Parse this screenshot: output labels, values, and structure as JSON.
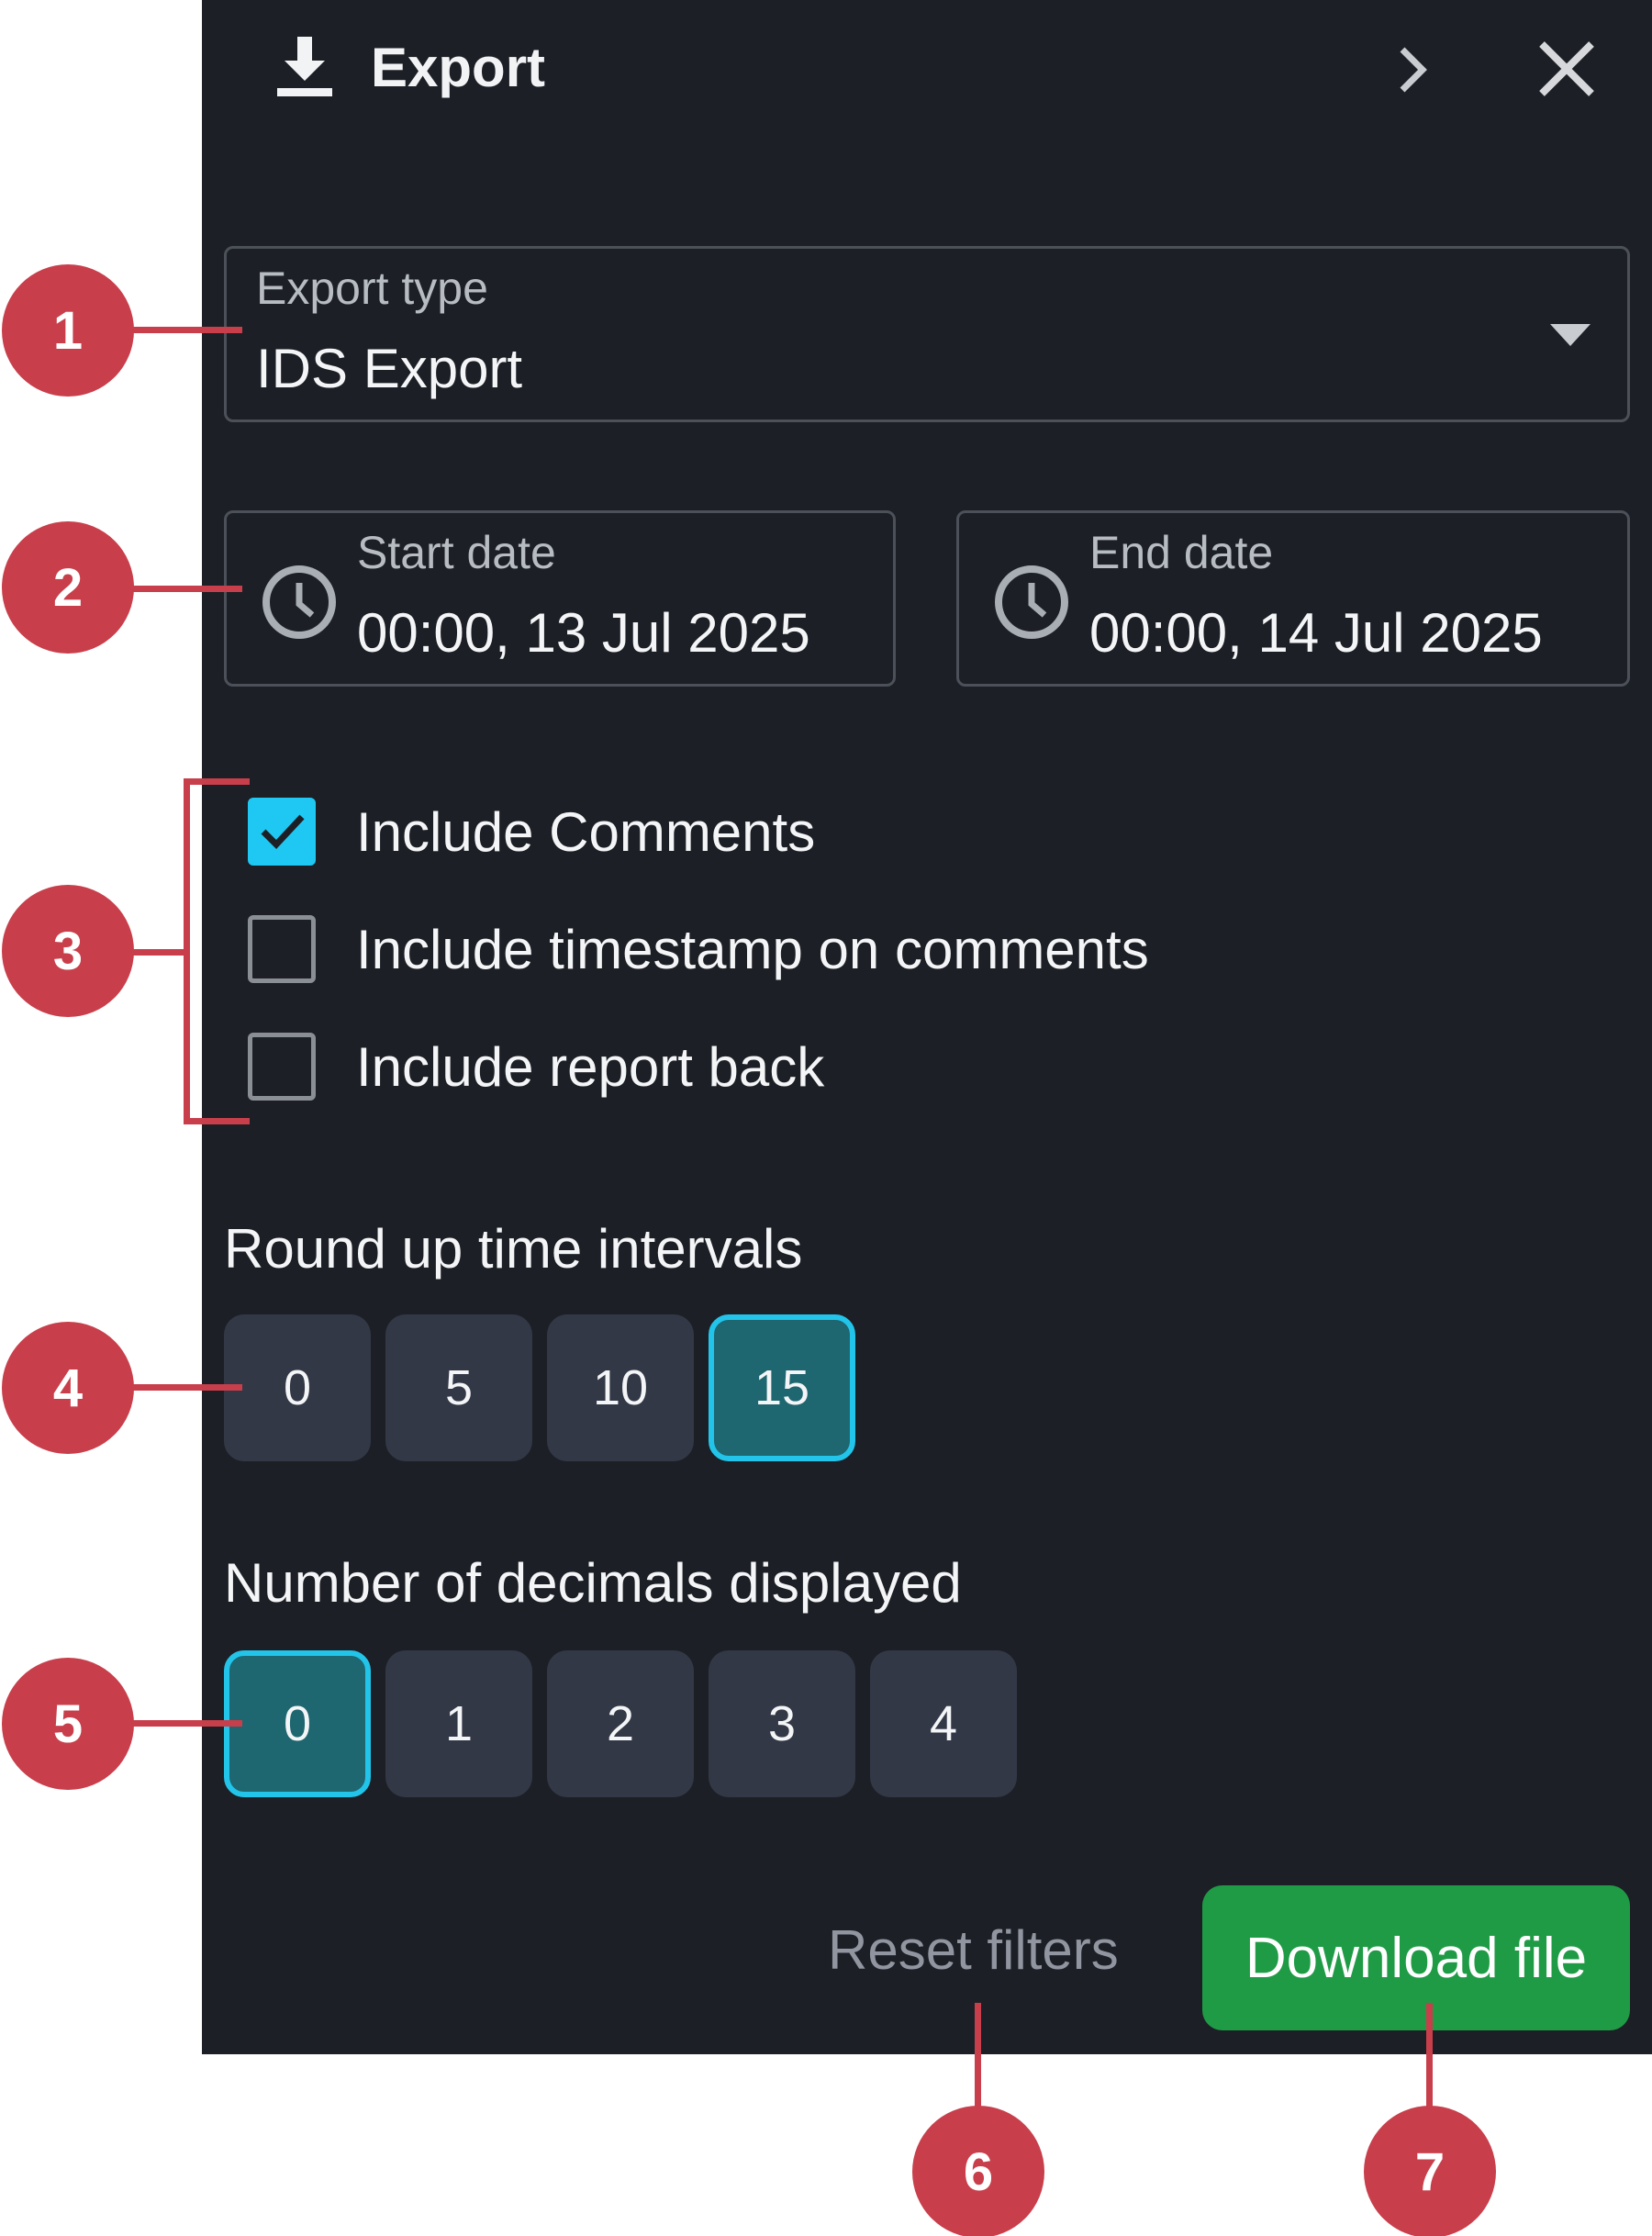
{
  "header": {
    "title": "Export",
    "icons": {
      "title_icon": "download-icon",
      "expand": "chevron-right-icon",
      "close": "close-icon"
    }
  },
  "export_type": {
    "label": "Export type",
    "value": "IDS Export"
  },
  "dates": {
    "start": {
      "label": "Start date",
      "value": "00:00, 13 Jul 2025"
    },
    "end": {
      "label": "End date",
      "value": "00:00, 14 Jul 2025"
    }
  },
  "options": {
    "include_comments": {
      "label": "Include Comments",
      "checked": true
    },
    "include_timestamp": {
      "label": "Include timestamp on comments",
      "checked": false
    },
    "include_report_back": {
      "label": "Include report back",
      "checked": false
    }
  },
  "round_up": {
    "label": "Round up time intervals",
    "values": [
      "0",
      "5",
      "10",
      "15"
    ],
    "selected": "15"
  },
  "decimals": {
    "label": "Number of decimals displayed",
    "values": [
      "0",
      "1",
      "2",
      "3",
      "4"
    ],
    "selected": "0"
  },
  "footer": {
    "reset_label": "Reset filters",
    "download_label": "Download file"
  },
  "callouts": [
    "1",
    "2",
    "3",
    "4",
    "5",
    "6",
    "7"
  ],
  "colors": {
    "panel_bg": "#1c1f25",
    "accent_cyan": "#1ec8f2",
    "selected_bg": "#1e6670",
    "download_green": "#1f9b46",
    "callout_red": "#c83f4b"
  }
}
